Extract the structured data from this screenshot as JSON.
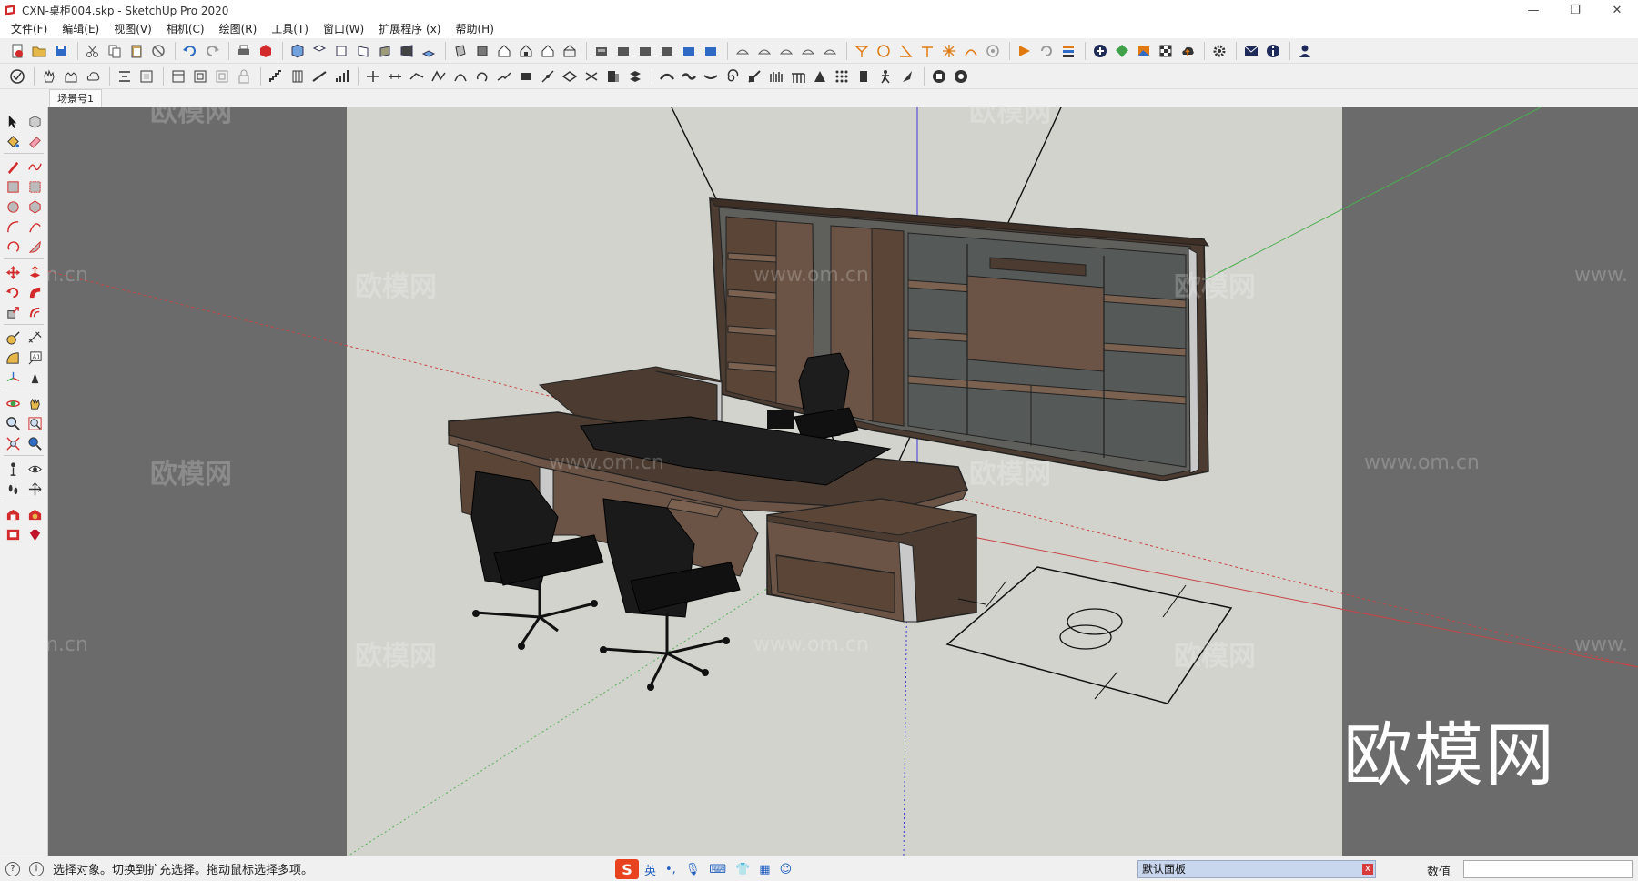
{
  "window": {
    "title": "CXN-桌柜004.skp - SketchUp Pro 2020",
    "controls": {
      "minimize": "—",
      "restore": "❐",
      "close": "✕"
    }
  },
  "menu": [
    "文件(F)",
    "编辑(E)",
    "视图(V)",
    "相机(C)",
    "绘图(R)",
    "工具(T)",
    "窗口(W)",
    "扩展程序 (x)",
    "帮助(H)"
  ],
  "scenes": {
    "active": "场景号1"
  },
  "watermarks": {
    "brand": "欧模网",
    "url": "www.om.cn",
    "url_short": "om.cn",
    "url_prefix": "www.",
    "big": "欧模网"
  },
  "status": {
    "hint": "选择对象。切换到扩充选择。拖动鼠标选择多项。",
    "ime": {
      "logo": "S",
      "lang": "英",
      "punct": "•,",
      "mic": "🎙",
      "keyboard": "⌨",
      "skin": "👕",
      "grid": "▦",
      "face": "☺"
    },
    "panel_label": "默认面板",
    "panel_close": "x",
    "measure_label": "数值",
    "measure_value": ""
  },
  "colors": {
    "viewport_bg": "#6b6b6b",
    "ground": "#d3d3cd",
    "wood_dark": "#4b3b30",
    "wood_mid": "#6b5446",
    "glass": "#5a5f5e",
    "axis_red": "#c94545",
    "axis_green": "#4caf50",
    "axis_blue": "#3a3ad6"
  }
}
